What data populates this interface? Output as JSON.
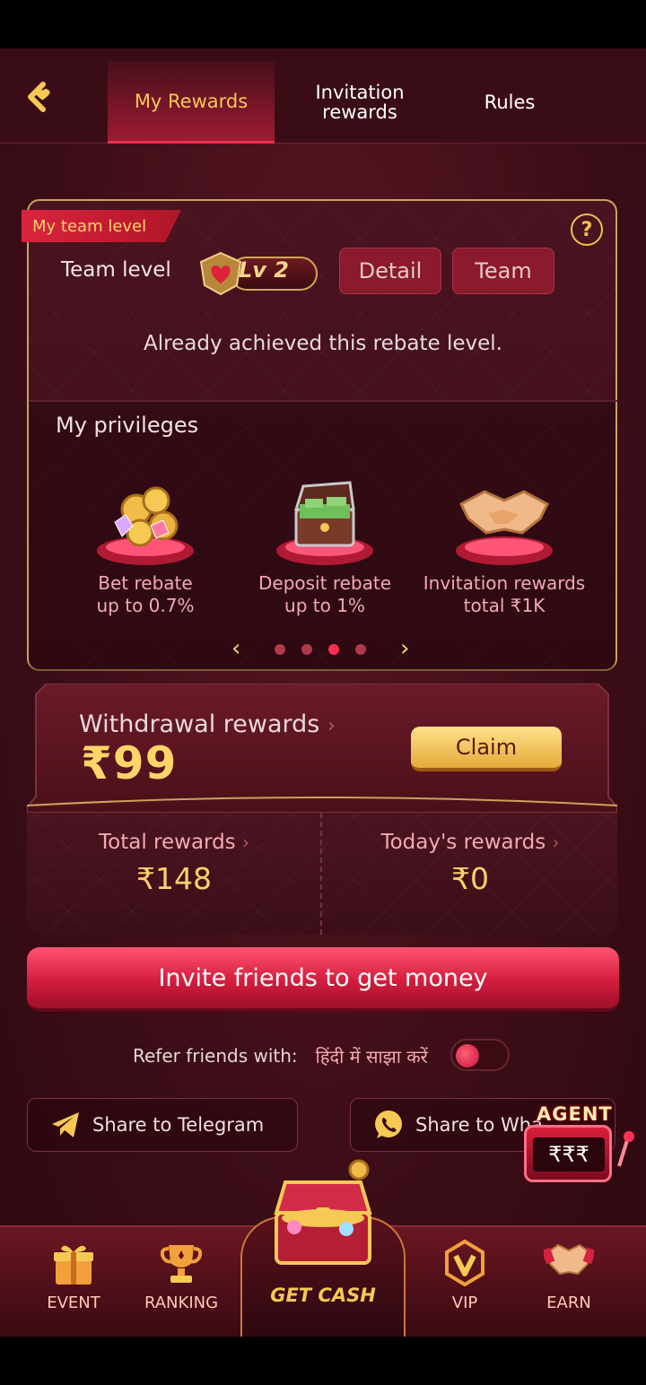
{
  "header": {
    "tabs": [
      {
        "label": "My Rewards",
        "active": true
      },
      {
        "label_line1": "Invitation",
        "label_line2": "rewards",
        "active": false
      },
      {
        "label": "Rules",
        "active": false
      }
    ]
  },
  "team": {
    "ribbon": "My team level",
    "team_level_label": "Team level",
    "level": "Lv 2",
    "detail_button": "Detail",
    "team_button": "Team",
    "status": "Already achieved this rebate level."
  },
  "privileges": {
    "title": "My privileges",
    "items": [
      {
        "line1": "Bet rebate",
        "line2": "up to 0.7%",
        "icon": "coins-gems-icon"
      },
      {
        "line1": "Deposit rebate",
        "line2": "up to 1%",
        "icon": "treasure-chest-icon"
      },
      {
        "line1": "Invitation rewards",
        "line2": "total ₹1K",
        "icon": "handshake-icon"
      }
    ],
    "carousel": {
      "total_dots": 4,
      "active_index": 2
    }
  },
  "withdrawal": {
    "label": "Withdrawal rewards",
    "amount": "₹99",
    "claim_button": "Claim"
  },
  "stats": {
    "total_label": "Total rewards",
    "total_value": "₹148",
    "today_label": "Today's rewards",
    "today_value": "₹0"
  },
  "invite_button": "Invite friends to get money",
  "refer": {
    "label": "Refer friends with:",
    "hindi": "हिंदी में साझा करें",
    "toggle_on": false
  },
  "share": {
    "telegram": "Share to Telegram",
    "whatsapp": "Share to Wha"
  },
  "agent": {
    "title": "AGENT",
    "reels": "₹₹₹"
  },
  "bottom_nav": {
    "event": "EVENT",
    "ranking": "RANKING",
    "get_cash": "GET CASH",
    "vip": "VIP",
    "earn": "EARN"
  },
  "colors": {
    "accent_gold": "#f6c955",
    "accent_red": "#e8324e",
    "background": "#3e0e18"
  }
}
